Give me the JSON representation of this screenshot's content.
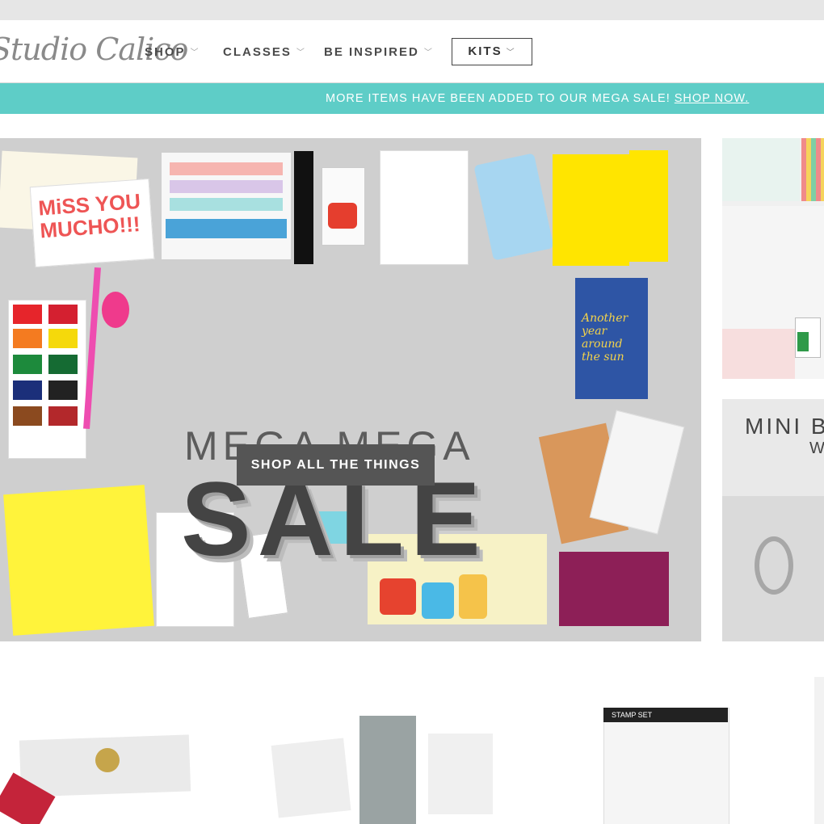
{
  "header": {
    "logo_text": "Studio Calico",
    "nav": [
      {
        "label": "SHOP"
      },
      {
        "label": "CLASSES"
      },
      {
        "label": "BE INSPIRED"
      }
    ],
    "kits_label": "KITS",
    "chevron_icon": "chevron-down-icon"
  },
  "promo": {
    "text": "MORE ITEMS HAVE BEEN ADDED TO OUR MEGA SALE!",
    "link": "SHOP NOW.",
    "color": "#5ecdc7"
  },
  "hero": {
    "line1": "MEGA MEGA",
    "line2": "SALE",
    "cta": "SHOP ALL THE THINGS",
    "card_text": "MiSS YOU MUCHO!!!",
    "tag_text": "Another year around the sun"
  },
  "side_banners": {
    "second_title": "MINI B",
    "second_sub": "W"
  },
  "products": {
    "stamp_label": "STAMP SET"
  }
}
